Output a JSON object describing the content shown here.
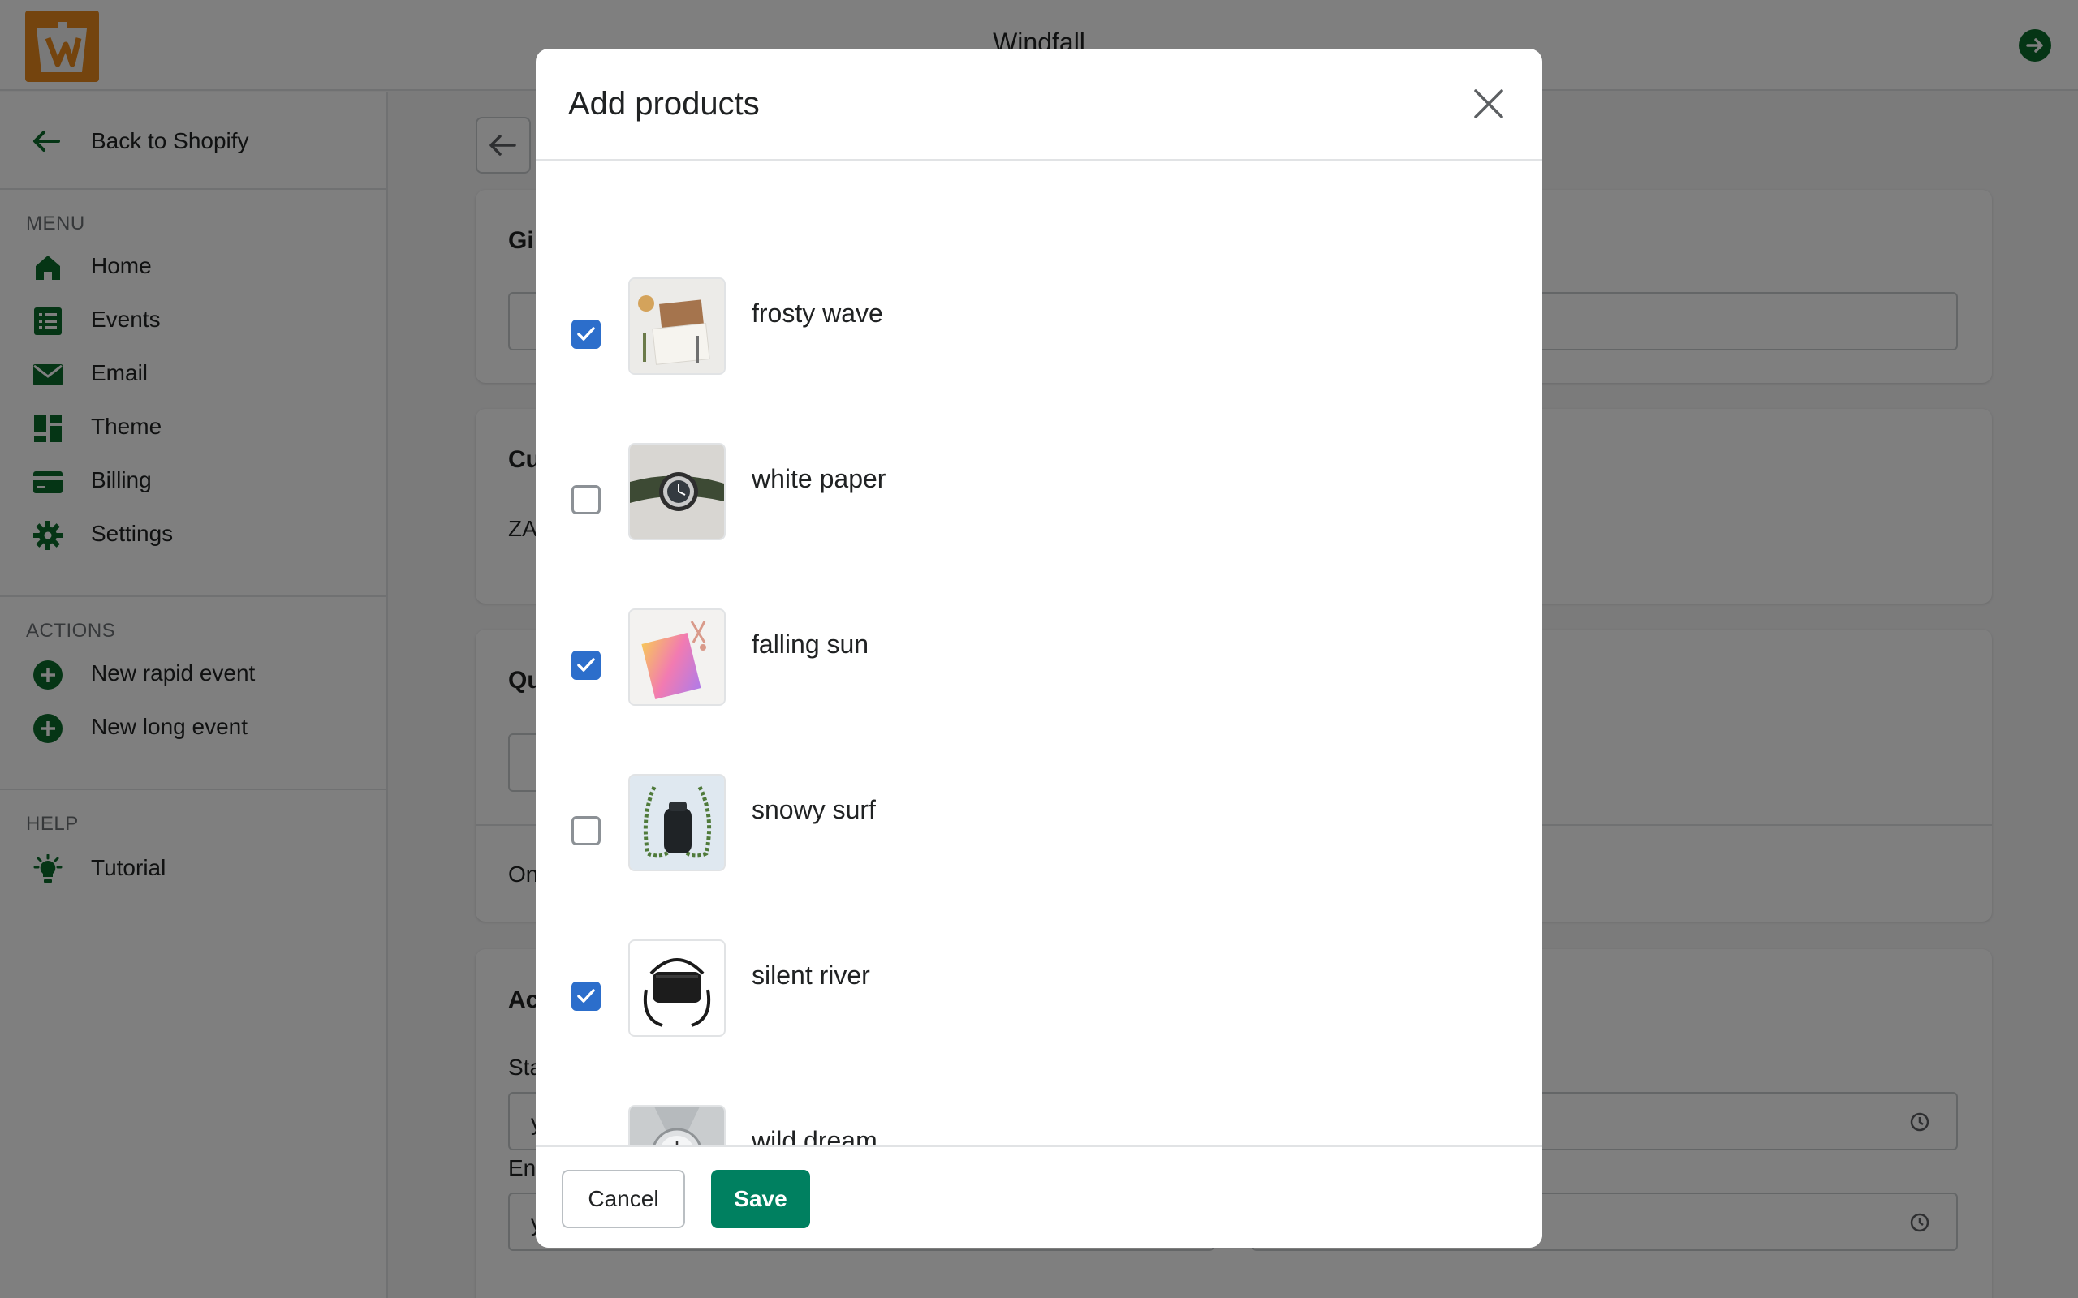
{
  "app": {
    "title": "Windfall",
    "brand_color": "#e8891c",
    "accent_color": "#0b6a2b"
  },
  "sidebar": {
    "back_label": "Back to Shopify",
    "menu_heading": "MENU",
    "menu_items": [
      {
        "label": "Home",
        "icon": "home-icon"
      },
      {
        "label": "Events",
        "icon": "list-icon"
      },
      {
        "label": "Email",
        "icon": "envelope-icon"
      },
      {
        "label": "Theme",
        "icon": "layout-icon"
      },
      {
        "label": "Billing",
        "icon": "credit-card-icon"
      },
      {
        "label": "Settings",
        "icon": "gear-icon"
      }
    ],
    "actions_heading": "ACTIONS",
    "action_items": [
      {
        "label": "New rapid event",
        "icon": "plus-circle-icon"
      },
      {
        "label": "New long event",
        "icon": "plus-circle-icon"
      }
    ],
    "help_heading": "HELP",
    "help_items": [
      {
        "label": "Tutorial",
        "icon": "lightbulb-icon"
      }
    ]
  },
  "background": {
    "card1_title": "Gi",
    "card2_title": "Cu",
    "card2_text": "ZA",
    "card3_title": "Qu",
    "card3_text": "On",
    "card4_title": "Ac",
    "card4_start_label": "Sta",
    "card4_end_label": "En",
    "field_prefix": "y"
  },
  "modal": {
    "title": "Add products",
    "products": [
      {
        "name": "frosty wave",
        "checked": true,
        "thumb": "notebook-thumb"
      },
      {
        "name": "white paper",
        "checked": false,
        "thumb": "watch-green-thumb"
      },
      {
        "name": "falling sun",
        "checked": true,
        "thumb": "card-thumb"
      },
      {
        "name": "snowy surf",
        "checked": false,
        "thumb": "bottle-holder-thumb"
      },
      {
        "name": "silent river",
        "checked": true,
        "thumb": "bag-thumb"
      },
      {
        "name": "wild dream",
        "checked": false,
        "thumb": "watch-silver-thumb"
      }
    ],
    "cancel_label": "Cancel",
    "save_label": "Save",
    "checkbox_color": "#2c6ecb",
    "save_color": "#008060"
  }
}
